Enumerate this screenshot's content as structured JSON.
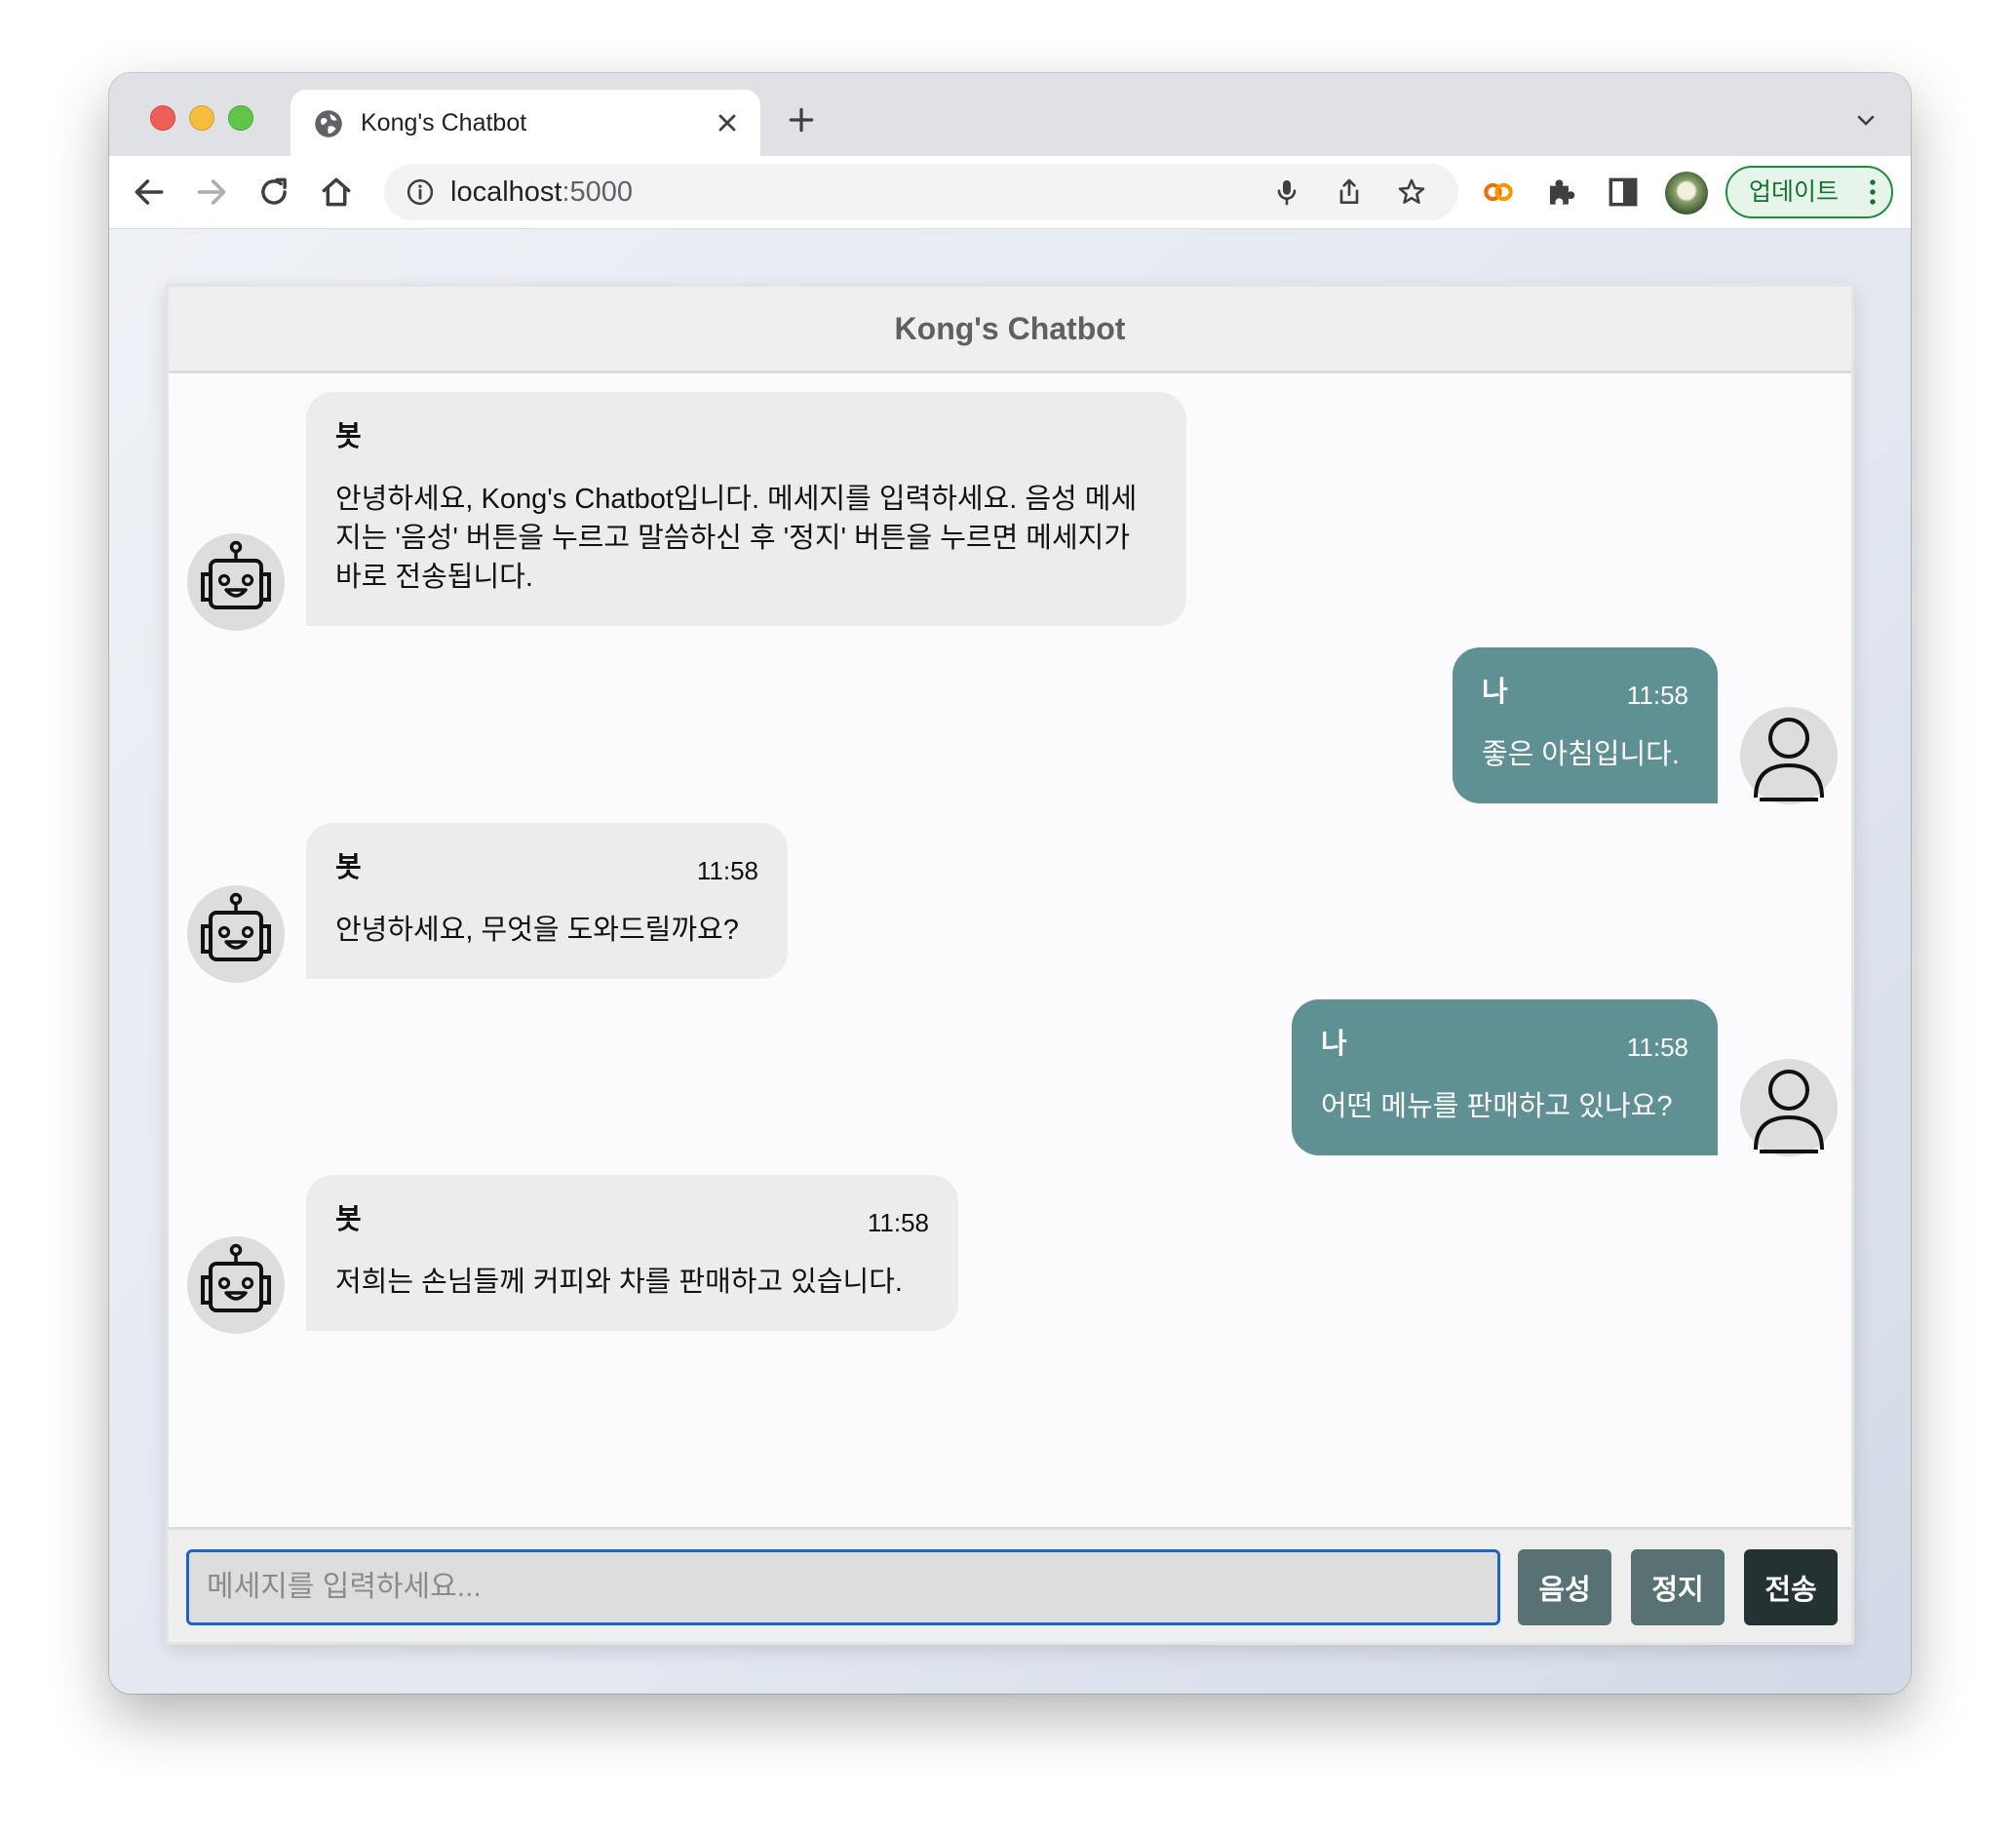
{
  "browser": {
    "tab_title": "Kong's Chatbot",
    "url_host": "localhost",
    "url_port": ":5000",
    "update_label": "업데이트",
    "accent_color": "#1e8e3e"
  },
  "chat": {
    "title": "Kong's Chatbot",
    "messages": [
      {
        "sender": "봇",
        "role": "bot",
        "time": "",
        "text": "안녕하세요, Kong's Chatbot입니다. 메세지를 입력하세요. 음성 메세지는 '음성' 버튼을 누르고 말씀하신 후 '정지' 버튼을 누르면 메세지가 바로 전송됩니다."
      },
      {
        "sender": "나",
        "role": "user",
        "time": "11:58",
        "text": "좋은 아침입니다."
      },
      {
        "sender": "봇",
        "role": "bot",
        "time": "11:58",
        "text": "안녕하세요, 무엇을 도와드릴까요?"
      },
      {
        "sender": "나",
        "role": "user",
        "time": "11:58",
        "text": "어떤 메뉴를 판매하고 있나요?"
      },
      {
        "sender": "봇",
        "role": "bot",
        "time": "11:58",
        "text": "저희는 손님들께 커피와 차를 판매하고 있습니다."
      }
    ],
    "bot_bubble_color": "#ececec",
    "user_bubble_color": "#5f9093"
  },
  "input": {
    "placeholder": "메세지를 입력하세요...",
    "value": "",
    "voice_label": "음성",
    "stop_label": "정지",
    "send_label": "전송"
  },
  "icons": {
    "bot_avatar": "robot-icon",
    "user_avatar": "user-icon"
  }
}
